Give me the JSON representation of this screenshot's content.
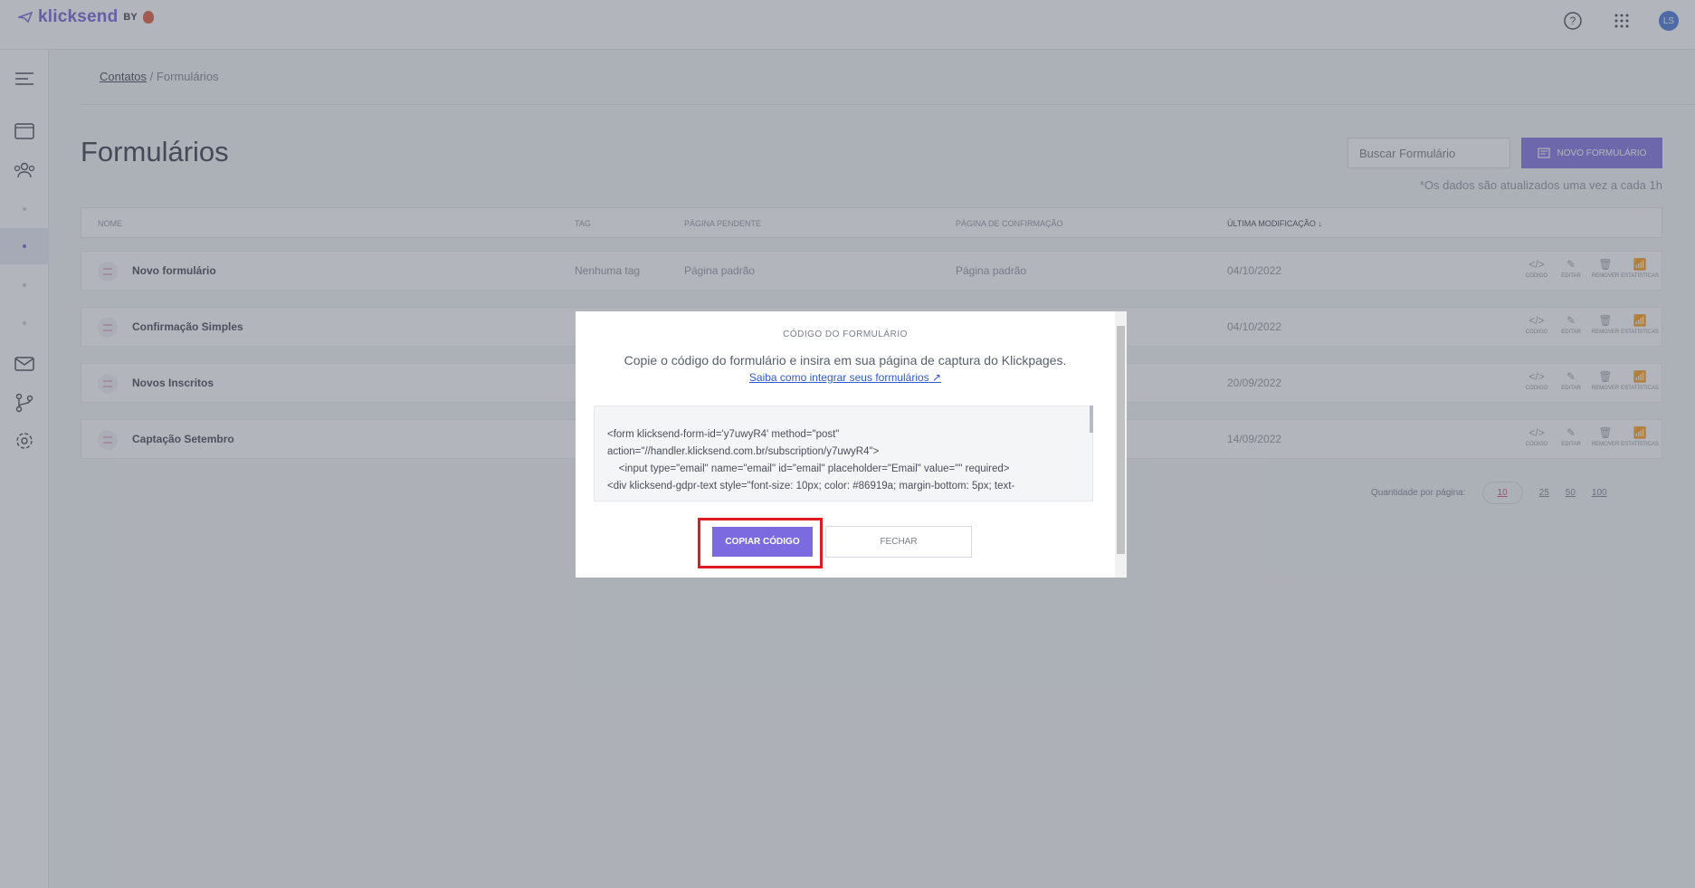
{
  "app": {
    "brand_name": "klicksend",
    "brand_by": "BY",
    "avatar_initials": "LS",
    "icons": [
      "help-circle-icon",
      "apps-grid-icon"
    ]
  },
  "breadcrumb": {
    "parent": "Contatos",
    "separator": "/",
    "current": "Formulários"
  },
  "page": {
    "title": "Formulários",
    "search_placeholder": "Buscar Formulário",
    "new_button_label": "NOVO FORMULÁRIO",
    "update_note": "*Os dados são atualizados uma vez a cada 1h"
  },
  "table": {
    "headers": {
      "name": "NOME",
      "tag": "TAG",
      "pending_page": "PÁGINA PENDENTE",
      "confirmation_page": "PÁGINA DE CONFIRMAÇÃO",
      "last_modified": "ÚLTIMA MODIFICAÇÃO ↓"
    },
    "rows": [
      {
        "name": "Novo formulário",
        "tag": "Nenhuma tag",
        "pending": "Página padrão",
        "confirmation": "Página padrão",
        "date": "04/10/2022"
      },
      {
        "name": "Confirmação Simples",
        "tag": "",
        "pending": "",
        "confirmation": "",
        "date": "04/10/2022"
      },
      {
        "name": "Novos Inscritos",
        "tag": "",
        "pending": "",
        "confirmation": "",
        "date": "20/09/2022"
      },
      {
        "name": "Captação Setembro",
        "tag": "",
        "pending": "",
        "confirmation": "",
        "date": "14/09/2022"
      }
    ],
    "actions": [
      "CÓDIGO",
      "EDITAR",
      "REMOVER",
      "ESTATÍSTICAS"
    ]
  },
  "pagination": {
    "label": "Quantidade por página:",
    "options": [
      "10",
      "25",
      "50",
      "100"
    ],
    "selected": "10"
  },
  "modal": {
    "title": "CÓDIGO DO FORMULÁRIO",
    "description": "Copie o código do formulário e insira em sua página de captura do Klickpages.",
    "link_text": "Saiba como integrar seus formulários",
    "code": "<form klicksend-form-id='y7uwyR4' method=\"post\"\naction=\"//handler.klicksend.com.br/subscription/y7uwyR4\">\n    <input type=\"email\" name=\"email\" id=\"email\" placeholder=\"Email\" value=\"\" required>\n<div klicksend-gdpr-text style=\"font-size: 10px; color: #86919a; margin-bottom: 5px; text-",
    "copy_button": "COPIAR CÓDIGO",
    "close_button": "FECHAR"
  },
  "colors": {
    "accent": "#7c6be0",
    "highlight": "#e11b22",
    "link": "#2f59d6"
  }
}
